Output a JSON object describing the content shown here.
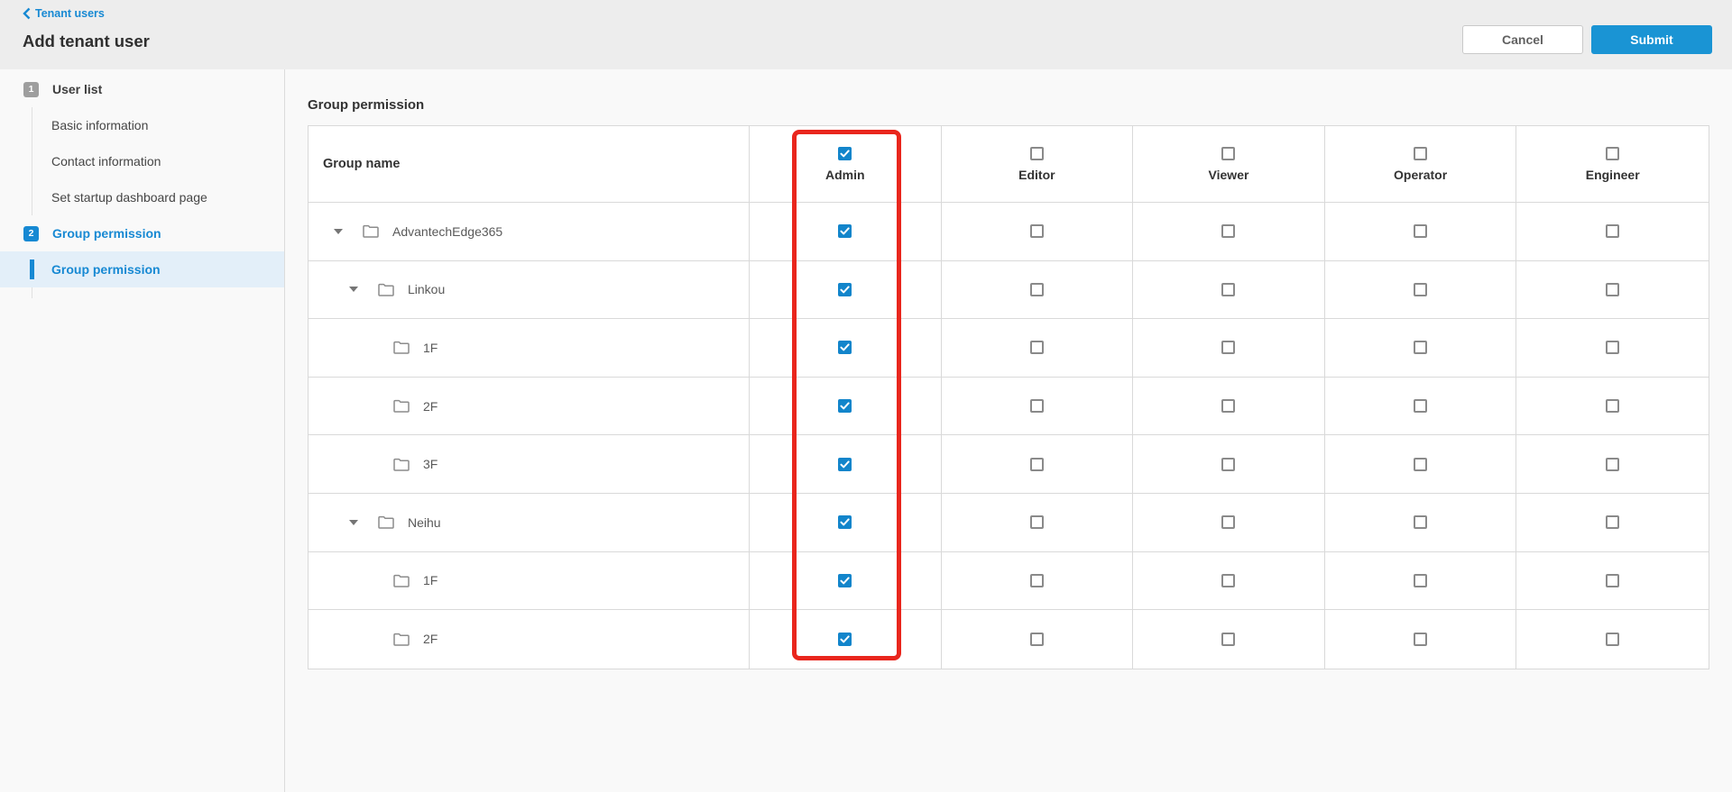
{
  "header": {
    "back_link": "Tenant users",
    "title": "Add tenant user",
    "cancel_button": "Cancel",
    "submit_button": "Submit"
  },
  "sidebar": {
    "steps": [
      {
        "number": "1",
        "label": "User list",
        "active": false,
        "children": [
          {
            "label": "Basic information",
            "active": false
          },
          {
            "label": "Contact information",
            "active": false
          },
          {
            "label": "Set startup dashboard page",
            "active": false
          }
        ]
      },
      {
        "number": "2",
        "label": "Group permission",
        "active": true,
        "children": [
          {
            "label": "Group permission",
            "active": true
          }
        ]
      }
    ]
  },
  "main": {
    "section_title": "Group permission",
    "table": {
      "name_column_header": "Group name",
      "permission_columns": [
        {
          "label": "Admin",
          "header_checked": true,
          "annotated": true
        },
        {
          "label": "Editor",
          "header_checked": false,
          "annotated": false
        },
        {
          "label": "Viewer",
          "header_checked": false,
          "annotated": false
        },
        {
          "label": "Operator",
          "header_checked": false,
          "annotated": false
        },
        {
          "label": "Engineer",
          "header_checked": false,
          "annotated": false
        }
      ],
      "groups": [
        {
          "name": "AdvantechEdge365",
          "level": 0,
          "expandable": true,
          "permissions": [
            true,
            false,
            false,
            false,
            false
          ]
        },
        {
          "name": "Linkou",
          "level": 1,
          "expandable": true,
          "permissions": [
            true,
            false,
            false,
            false,
            false
          ]
        },
        {
          "name": "1F",
          "level": 2,
          "expandable": false,
          "permissions": [
            true,
            false,
            false,
            false,
            false
          ]
        },
        {
          "name": "2F",
          "level": 2,
          "expandable": false,
          "permissions": [
            true,
            false,
            false,
            false,
            false
          ]
        },
        {
          "name": "3F",
          "level": 2,
          "expandable": false,
          "permissions": [
            true,
            false,
            false,
            false,
            false
          ]
        },
        {
          "name": "Neihu",
          "level": 1,
          "expandable": true,
          "permissions": [
            true,
            false,
            false,
            false,
            false
          ]
        },
        {
          "name": "1F",
          "level": 2,
          "expandable": false,
          "permissions": [
            true,
            false,
            false,
            false,
            false
          ]
        },
        {
          "name": "2F",
          "level": 2,
          "expandable": false,
          "permissions": [
            true,
            false,
            false,
            false,
            false
          ]
        }
      ]
    },
    "annotation": {
      "shape": "rectangle",
      "marks": "Admin column",
      "color": "#e9261d"
    }
  },
  "colors": {
    "accent_blue": "#1789d3",
    "checkbox_blue": "#1285cb",
    "submit_blue": "#1a94d4",
    "annotation_red": "#e9261d",
    "step_badge_gray": "#9e9e9e",
    "header_bar_gray": "#ededed",
    "table_border_gray": "#d9d9d9"
  }
}
